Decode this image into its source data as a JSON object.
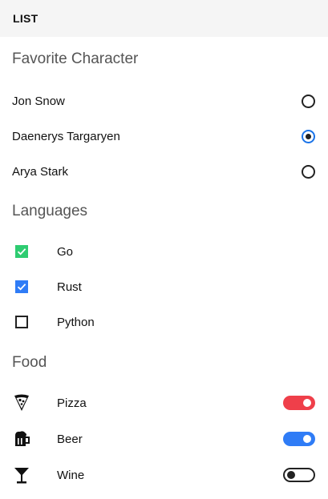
{
  "header": {
    "title": "LIST"
  },
  "sections": {
    "character": {
      "title": "Favorite Character",
      "items": [
        {
          "label": "Jon Snow",
          "checked": false
        },
        {
          "label": "Daenerys Targaryen",
          "checked": true
        },
        {
          "label": "Arya Stark",
          "checked": false
        }
      ]
    },
    "languages": {
      "title": "Languages",
      "items": [
        {
          "label": "Go",
          "checked": true,
          "color": "#2ecc71"
        },
        {
          "label": "Rust",
          "checked": true,
          "color": "#2f7cf6"
        },
        {
          "label": "Python",
          "checked": false
        }
      ]
    },
    "food": {
      "title": "Food",
      "items": [
        {
          "label": "Pizza",
          "icon": "pizza-icon",
          "on": true,
          "color": "#ef3f4a"
        },
        {
          "label": "Beer",
          "icon": "beer-icon",
          "on": true,
          "color": "#2f7cf6"
        },
        {
          "label": "Wine",
          "icon": "wine-glass-icon",
          "on": false
        }
      ]
    }
  },
  "colors": {
    "header_bg": "#f5f5f5",
    "radio_selected_ring": "#1a73e8"
  }
}
